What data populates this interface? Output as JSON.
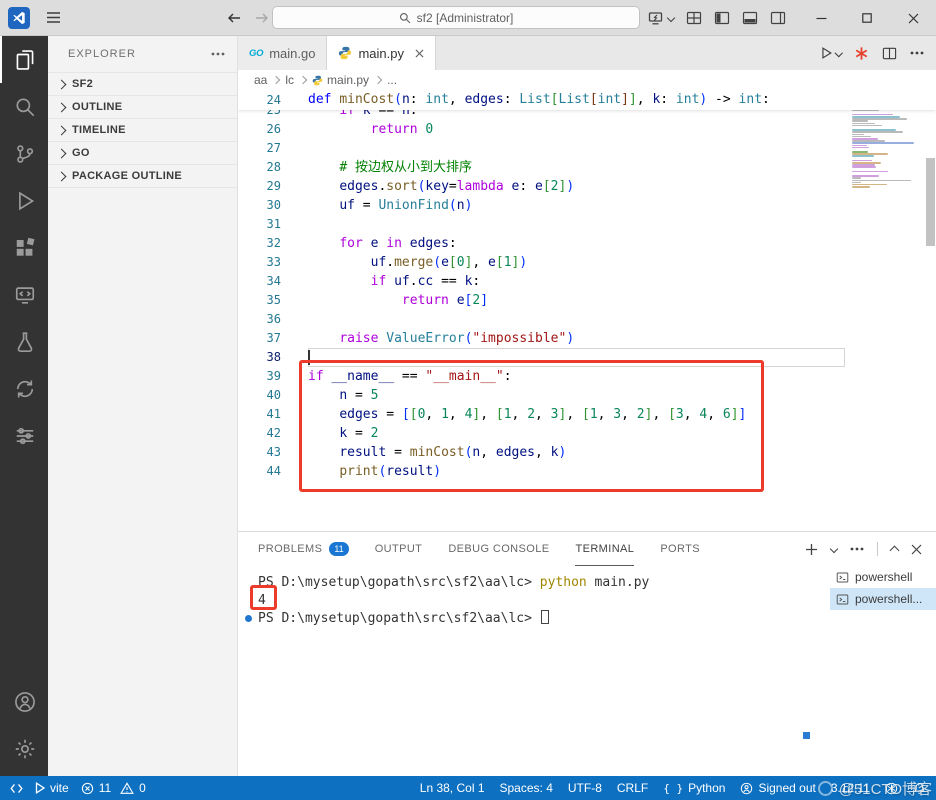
{
  "titlebar": {
    "search": "sf2 [Administrator]"
  },
  "activity": {
    "items": [
      {
        "name": "explorer",
        "active": true
      },
      {
        "name": "search"
      },
      {
        "name": "source-control"
      },
      {
        "name": "run-debug"
      },
      {
        "name": "extensions"
      },
      {
        "name": "remote"
      },
      {
        "name": "testing"
      },
      {
        "name": "sync"
      },
      {
        "name": "tools"
      }
    ],
    "bottom": [
      {
        "name": "account"
      },
      {
        "name": "settings"
      }
    ]
  },
  "sidebar": {
    "title": "EXPLORER",
    "sections": [
      {
        "label": "SF2"
      },
      {
        "label": "OUTLINE"
      },
      {
        "label": "TIMELINE"
      },
      {
        "label": "GO"
      },
      {
        "label": "PACKAGE OUTLINE"
      }
    ]
  },
  "tabs": [
    {
      "label": "main.go",
      "icon": "go",
      "icon_text": "GO"
    },
    {
      "label": "main.py",
      "icon": "py",
      "active": true
    }
  ],
  "breadcrumb": {
    "items": [
      {
        "label": "aa"
      },
      {
        "label": "lc"
      },
      {
        "label": "main.py",
        "icon": "py"
      },
      {
        "label": "..."
      }
    ]
  },
  "editor": {
    "current_line": 38,
    "sticky": {
      "n": 24,
      "t": [
        [
          "d",
          "def "
        ],
        [
          "f",
          "minCost"
        ],
        [
          "b1",
          "("
        ],
        [
          "v",
          "n"
        ],
        [
          "p",
          ": "
        ],
        [
          "t",
          "int"
        ],
        [
          "p",
          ", "
        ],
        [
          "v",
          "edges"
        ],
        [
          "p",
          ": "
        ],
        [
          "t",
          "List"
        ],
        [
          "b2",
          "["
        ],
        [
          "t",
          "List"
        ],
        [
          "b3",
          "["
        ],
        [
          "t",
          "int"
        ],
        [
          "b3",
          "]"
        ],
        [
          "b2",
          "]"
        ],
        [
          "p",
          ", "
        ],
        [
          "v",
          "k"
        ],
        [
          "p",
          ": "
        ],
        [
          "t",
          "int"
        ],
        [
          "b1",
          ")"
        ],
        [
          "p",
          " -> "
        ],
        [
          "t",
          "int"
        ],
        [
          "p",
          ":"
        ]
      ]
    },
    "lines": [
      {
        "n": 25,
        "clip": true,
        "t": [
          [
            "p",
            "    "
          ],
          [
            "k",
            "if "
          ],
          [
            "v",
            "k"
          ],
          [
            "p",
            " == "
          ],
          [
            "v",
            "n"
          ],
          [
            "p",
            ":"
          ]
        ]
      },
      {
        "n": 26,
        "t": [
          [
            "p",
            "        "
          ],
          [
            "k",
            "return "
          ],
          [
            "n",
            "0"
          ]
        ]
      },
      {
        "n": 27,
        "t": []
      },
      {
        "n": 28,
        "t": [
          [
            "p",
            "    "
          ],
          [
            "c",
            "# 按边权从小到大排序"
          ]
        ]
      },
      {
        "n": 29,
        "t": [
          [
            "p",
            "    "
          ],
          [
            "v",
            "edges"
          ],
          [
            "p",
            "."
          ],
          [
            "f",
            "sort"
          ],
          [
            "b1",
            "("
          ],
          [
            "v",
            "key"
          ],
          [
            "p",
            "="
          ],
          [
            "k",
            "lambda"
          ],
          [
            "p",
            " "
          ],
          [
            "v",
            "e"
          ],
          [
            "p",
            ": "
          ],
          [
            "v",
            "e"
          ],
          [
            "b2",
            "["
          ],
          [
            "n",
            "2"
          ],
          [
            "b2",
            "]"
          ],
          [
            "b1",
            ")"
          ]
        ]
      },
      {
        "n": 30,
        "t": [
          [
            "p",
            "    "
          ],
          [
            "v",
            "uf"
          ],
          [
            "p",
            " = "
          ],
          [
            "t",
            "UnionFind"
          ],
          [
            "b1",
            "("
          ],
          [
            "v",
            "n"
          ],
          [
            "b1",
            ")"
          ]
        ]
      },
      {
        "n": 31,
        "t": []
      },
      {
        "n": 32,
        "t": [
          [
            "p",
            "    "
          ],
          [
            "k",
            "for "
          ],
          [
            "v",
            "e"
          ],
          [
            "k",
            " in "
          ],
          [
            "v",
            "edges"
          ],
          [
            "p",
            ":"
          ]
        ]
      },
      {
        "n": 33,
        "t": [
          [
            "p",
            "        "
          ],
          [
            "v",
            "uf"
          ],
          [
            "p",
            "."
          ],
          [
            "f",
            "merge"
          ],
          [
            "b1",
            "("
          ],
          [
            "v",
            "e"
          ],
          [
            "b2",
            "["
          ],
          [
            "n",
            "0"
          ],
          [
            "b2",
            "]"
          ],
          [
            "p",
            ", "
          ],
          [
            "v",
            "e"
          ],
          [
            "b2",
            "["
          ],
          [
            "n",
            "1"
          ],
          [
            "b2",
            "]"
          ],
          [
            "b1",
            ")"
          ]
        ]
      },
      {
        "n": 34,
        "t": [
          [
            "p",
            "        "
          ],
          [
            "k",
            "if "
          ],
          [
            "v",
            "uf"
          ],
          [
            "p",
            "."
          ],
          [
            "v",
            "cc"
          ],
          [
            "p",
            " == "
          ],
          [
            "v",
            "k"
          ],
          [
            "p",
            ":"
          ]
        ]
      },
      {
        "n": 35,
        "t": [
          [
            "p",
            "            "
          ],
          [
            "k",
            "return "
          ],
          [
            "v",
            "e"
          ],
          [
            "b1",
            "["
          ],
          [
            "n",
            "2"
          ],
          [
            "b1",
            "]"
          ]
        ]
      },
      {
        "n": 36,
        "t": []
      },
      {
        "n": 37,
        "t": [
          [
            "p",
            "    "
          ],
          [
            "k",
            "raise "
          ],
          [
            "t",
            "ValueError"
          ],
          [
            "b1",
            "("
          ],
          [
            "s",
            "\"impossible\""
          ],
          [
            "b1",
            ")"
          ]
        ]
      },
      {
        "n": 38,
        "t": []
      },
      {
        "n": 39,
        "t": [
          [
            "k",
            "if "
          ],
          [
            "v",
            "__name__"
          ],
          [
            "p",
            " == "
          ],
          [
            "s",
            "\"__main__\""
          ],
          [
            "p",
            ":"
          ]
        ]
      },
      {
        "n": 40,
        "t": [
          [
            "p",
            "    "
          ],
          [
            "v",
            "n"
          ],
          [
            "p",
            " = "
          ],
          [
            "n",
            "5"
          ]
        ]
      },
      {
        "n": 41,
        "t": [
          [
            "p",
            "    "
          ],
          [
            "v",
            "edges"
          ],
          [
            "p",
            " = "
          ],
          [
            "b1",
            "["
          ],
          [
            "b2",
            "["
          ],
          [
            "n",
            "0"
          ],
          [
            "p",
            ", "
          ],
          [
            "n",
            "1"
          ],
          [
            "p",
            ", "
          ],
          [
            "n",
            "4"
          ],
          [
            "b2",
            "]"
          ],
          [
            "p",
            ", "
          ],
          [
            "b2",
            "["
          ],
          [
            "n",
            "1"
          ],
          [
            "p",
            ", "
          ],
          [
            "n",
            "2"
          ],
          [
            "p",
            ", "
          ],
          [
            "n",
            "3"
          ],
          [
            "b2",
            "]"
          ],
          [
            "p",
            ", "
          ],
          [
            "b2",
            "["
          ],
          [
            "n",
            "1"
          ],
          [
            "p",
            ", "
          ],
          [
            "n",
            "3"
          ],
          [
            "p",
            ", "
          ],
          [
            "n",
            "2"
          ],
          [
            "b2",
            "]"
          ],
          [
            "p",
            ", "
          ],
          [
            "b2",
            "["
          ],
          [
            "n",
            "3"
          ],
          [
            "p",
            ", "
          ],
          [
            "n",
            "4"
          ],
          [
            "p",
            ", "
          ],
          [
            "n",
            "6"
          ],
          [
            "b2",
            "]"
          ],
          [
            "b1",
            "]"
          ]
        ]
      },
      {
        "n": 42,
        "t": [
          [
            "p",
            "    "
          ],
          [
            "v",
            "k"
          ],
          [
            "p",
            " = "
          ],
          [
            "n",
            "2"
          ]
        ]
      },
      {
        "n": 43,
        "t": [
          [
            "p",
            "    "
          ],
          [
            "v",
            "result"
          ],
          [
            "p",
            " = "
          ],
          [
            "f",
            "minCost"
          ],
          [
            "b1",
            "("
          ],
          [
            "v",
            "n"
          ],
          [
            "p",
            ", "
          ],
          [
            "v",
            "edges"
          ],
          [
            "p",
            ", "
          ],
          [
            "v",
            "k"
          ],
          [
            "b1",
            ")"
          ]
        ]
      },
      {
        "n": 44,
        "t": [
          [
            "p",
            "    "
          ],
          [
            "f",
            "print"
          ],
          [
            "b1",
            "("
          ],
          [
            "v",
            "result"
          ],
          [
            "b1",
            ")"
          ]
        ]
      }
    ]
  },
  "panel": {
    "tabs": [
      {
        "label": "PROBLEMS",
        "badge": "11"
      },
      {
        "label": "OUTPUT"
      },
      {
        "label": "DEBUG CONSOLE"
      },
      {
        "label": "TERMINAL",
        "active": true
      },
      {
        "label": "PORTS"
      }
    ]
  },
  "terminal": {
    "lines": [
      {
        "seg": [
          [
            "prompt",
            "PS D:\\mysetup\\gopath\\src\\sf2\\aa\\lc> "
          ],
          [
            "cmd",
            "python"
          ],
          [
            "plain",
            " main.py"
          ]
        ]
      },
      {
        "seg": [
          [
            "plain",
            "4"
          ]
        ]
      },
      {
        "dot": true,
        "cursor": true,
        "seg": [
          [
            "prompt",
            "PS D:\\mysetup\\gopath\\src\\sf2\\aa\\lc> "
          ]
        ]
      }
    ],
    "profiles": [
      {
        "label": "powershell"
      },
      {
        "label": "powershell...",
        "selected": true
      }
    ]
  },
  "statusbar": {
    "task": "vite",
    "errors": "11",
    "warnings": "0",
    "line_col": "Ln 38, Col 1",
    "spaces": "Spaces: 4",
    "encoding": "UTF-8",
    "eol": "CRLF",
    "language_icon": "{ }",
    "language": "Python",
    "account": "Signed out",
    "version": "3.12.11"
  },
  "watermark": {
    "text": "@51CTO博客"
  }
}
